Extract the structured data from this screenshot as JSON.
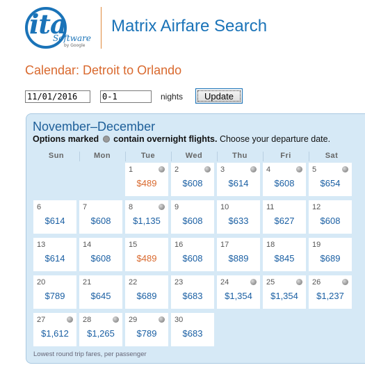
{
  "header": {
    "logo_text": "ita",
    "logo_sub": "Software",
    "logo_byline": "by Google",
    "app_title": "Matrix Airfare Search"
  },
  "page_heading": "Calendar: Detroit to Orlando",
  "controls": {
    "start_date": "11/01/2016",
    "nights": "0-1",
    "nights_label": "nights",
    "update_label": "Update"
  },
  "calendar": {
    "title": "November–December",
    "note_bold_1": "Options marked",
    "note_bold_2": "contain overnight flights.",
    "note_rest": "Choose your departure date.",
    "weekdays": [
      "Sun",
      "Mon",
      "Tue",
      "Wed",
      "Thu",
      "Fri",
      "Sat"
    ],
    "footer": "Lowest round trip fares, per passenger",
    "days": [
      {
        "day": "1",
        "price": "$489",
        "overnight": true,
        "cheapest": true
      },
      {
        "day": "2",
        "price": "$608",
        "overnight": true,
        "cheapest": false
      },
      {
        "day": "3",
        "price": "$614",
        "overnight": true,
        "cheapest": false
      },
      {
        "day": "4",
        "price": "$608",
        "overnight": true,
        "cheapest": false
      },
      {
        "day": "5",
        "price": "$654",
        "overnight": true,
        "cheapest": false
      },
      {
        "day": "6",
        "price": "$614",
        "overnight": false,
        "cheapest": false
      },
      {
        "day": "7",
        "price": "$608",
        "overnight": false,
        "cheapest": false
      },
      {
        "day": "8",
        "price": "$1,135",
        "overnight": true,
        "cheapest": false
      },
      {
        "day": "9",
        "price": "$608",
        "overnight": false,
        "cheapest": false
      },
      {
        "day": "10",
        "price": "$633",
        "overnight": false,
        "cheapest": false
      },
      {
        "day": "11",
        "price": "$627",
        "overnight": false,
        "cheapest": false
      },
      {
        "day": "12",
        "price": "$608",
        "overnight": false,
        "cheapest": false
      },
      {
        "day": "13",
        "price": "$614",
        "overnight": false,
        "cheapest": false
      },
      {
        "day": "14",
        "price": "$608",
        "overnight": false,
        "cheapest": false
      },
      {
        "day": "15",
        "price": "$489",
        "overnight": false,
        "cheapest": true
      },
      {
        "day": "16",
        "price": "$608",
        "overnight": false,
        "cheapest": false
      },
      {
        "day": "17",
        "price": "$889",
        "overnight": false,
        "cheapest": false
      },
      {
        "day": "18",
        "price": "$845",
        "overnight": false,
        "cheapest": false
      },
      {
        "day": "19",
        "price": "$689",
        "overnight": false,
        "cheapest": false
      },
      {
        "day": "20",
        "price": "$789",
        "overnight": false,
        "cheapest": false
      },
      {
        "day": "21",
        "price": "$645",
        "overnight": false,
        "cheapest": false
      },
      {
        "day": "22",
        "price": "$689",
        "overnight": false,
        "cheapest": false
      },
      {
        "day": "23",
        "price": "$683",
        "overnight": false,
        "cheapest": false
      },
      {
        "day": "24",
        "price": "$1,354",
        "overnight": true,
        "cheapest": false
      },
      {
        "day": "25",
        "price": "$1,354",
        "overnight": true,
        "cheapest": false
      },
      {
        "day": "26",
        "price": "$1,237",
        "overnight": true,
        "cheapest": false
      },
      {
        "day": "27",
        "price": "$1,612",
        "overnight": true,
        "cheapest": false
      },
      {
        "day": "28",
        "price": "$1,265",
        "overnight": true,
        "cheapest": false
      },
      {
        "day": "29",
        "price": "$789",
        "overnight": true,
        "cheapest": false
      },
      {
        "day": "30",
        "price": "$683",
        "overnight": false,
        "cheapest": false
      }
    ]
  },
  "colors": {
    "brand_blue": "#1a73b8",
    "accent_orange": "#d9692e",
    "panel_bg": "#d6e9f6"
  }
}
